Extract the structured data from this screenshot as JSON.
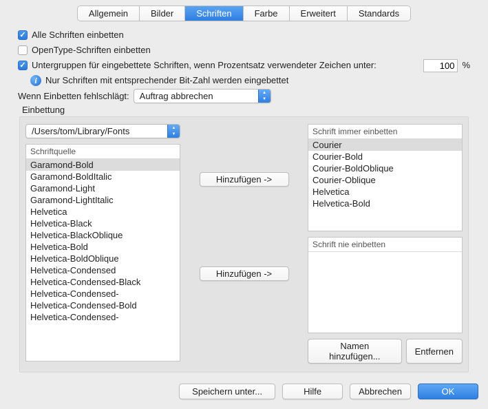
{
  "tabs": {
    "items": [
      "Allgemein",
      "Bilder",
      "Schriften",
      "Farbe",
      "Erweitert",
      "Standards"
    ],
    "activeIndex": 2
  },
  "options": {
    "embedAll": "Alle Schriften einbetten",
    "embedOpenType": "OpenType-Schriften einbetten",
    "subset": "Untergruppen für eingebettete Schriften, wenn Prozentsatz verwendeter Zeichen unter:",
    "subsetValue": "100",
    "percentSign": "%",
    "infoNote": "Nur Schriften mit entsprechender Bit-Zahl werden eingebettet"
  },
  "failure": {
    "label": "Wenn Einbetten fehlschlägt:",
    "value": "Auftrag abbrechen"
  },
  "embedding": {
    "sectionLabel": "Einbettung",
    "sourcePath": "/Users/tom/Library/Fonts",
    "sourceHeader": "Schriftquelle",
    "sourceFonts": [
      "Garamond-Bold",
      "Garamond-BoldItalic",
      "Garamond-Light",
      "Garamond-LightItalic",
      "Helvetica",
      "Helvetica-Black",
      "Helvetica-BlackOblique",
      "Helvetica-Bold",
      "Helvetica-BoldOblique",
      "Helvetica-Condensed",
      "Helvetica-Condensed-Black",
      "Helvetica-Condensed-",
      "Helvetica-Condensed-Bold",
      "Helvetica-Condensed-"
    ],
    "sourceSelectedIndex": 0,
    "addTop": "Hinzufügen ->",
    "addBottom": "Hinzufügen ->",
    "alwaysHeader": "Schrift immer einbetten",
    "alwaysFonts": [
      "Courier",
      "Courier-Bold",
      "Courier-BoldOblique",
      "Courier-Oblique",
      "Helvetica",
      "Helvetica-Bold"
    ],
    "alwaysSelectedIndex": 0,
    "neverHeader": "Schrift nie einbetten",
    "addName": "Namen hinzufügen...",
    "remove": "Entfernen"
  },
  "footer": {
    "saveAs": "Speichern unter...",
    "help": "Hilfe",
    "cancel": "Abbrechen",
    "ok": "OK"
  }
}
